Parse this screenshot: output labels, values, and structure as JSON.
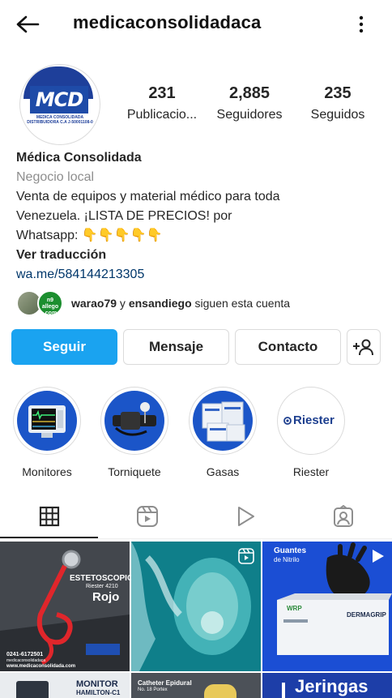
{
  "header": {
    "username": "medicaconsolidadaca",
    "back_icon": "arrow-left-icon",
    "more_icon": "more-vertical-icon"
  },
  "avatar": {
    "logo_text": "MCD",
    "sub_text": "MEDICA CONSOLIDADA DISTRIBUIDORA C.A J-50001108-0"
  },
  "stats": {
    "posts_value": "231",
    "posts_label": "Publicacio...",
    "followers_value": "2,885",
    "followers_label": "Seguidores",
    "following_value": "235",
    "following_label": "Seguidos"
  },
  "bio": {
    "name": "Médica Consolidada",
    "category": "Negocio local",
    "line1": "Venta de equipos y material médico para toda",
    "line2": "Venezuela. ¡LISTA DE PRECIOS! por",
    "line3": "Whatsapp: 👇👇👇👇👇",
    "translate": "Ver traducción",
    "link": "wa.me/584144213305"
  },
  "followed_by": {
    "user1": "warao79",
    "conjunction": " y ",
    "user2": "ensandiego",
    "suffix": " siguen esta cuenta",
    "avatar2_text": "n9 allego .com"
  },
  "buttons": {
    "follow": "Seguir",
    "message": "Mensaje",
    "contact": "Contacto",
    "add_user_icon": "person-add-icon"
  },
  "highlights": [
    {
      "label": "Monitores"
    },
    {
      "label": "Torniquete"
    },
    {
      "label": "Gasas"
    },
    {
      "label": "Riester",
      "logo": "Riester"
    }
  ],
  "tabs": [
    {
      "icon": "grid-icon",
      "active": true
    },
    {
      "icon": "reels-icon"
    },
    {
      "icon": "play-icon"
    },
    {
      "icon": "tagged-icon"
    }
  ],
  "posts": [
    {
      "title": "ESTETOSCOPIO",
      "subtitle": "Riester 4210",
      "color_label": "Rojo",
      "phone": "0241-6172501",
      "handle": "medicaconsolidadaca",
      "site": "www.medicaconsolidada.com"
    },
    {
      "type": "reel"
    },
    {
      "title": "Guantes",
      "subtitle": "de Nitrilo",
      "brand": "DERMAGRIP",
      "maker": "WRP"
    },
    {
      "title": "MONITOR",
      "subtitle": "HAMILTON-C1"
    },
    {
      "title": "Catheter Epidural",
      "subtitle": "No. 18 Portex"
    },
    {
      "title": "Jeringas"
    }
  ]
}
